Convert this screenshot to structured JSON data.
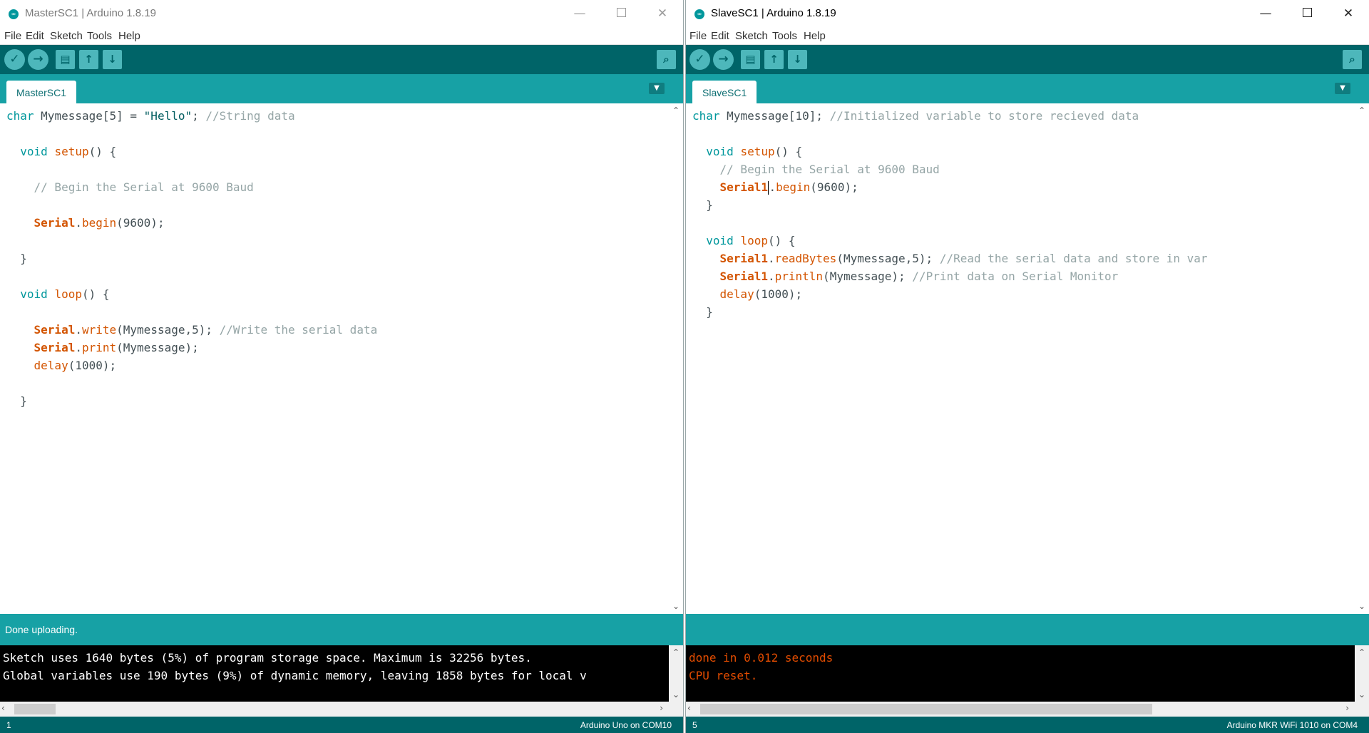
{
  "windows": {
    "master": {
      "title": "MasterSC1 | Arduino 1.8.19",
      "menu": [
        "File",
        "Edit",
        "Sketch",
        "Tools",
        "Help"
      ],
      "tab": "MasterSC1",
      "status": "Done uploading.",
      "console_lines": [
        "Sketch uses 1640 bytes (5%) of program storage space. Maximum is 32256 bytes.",
        "Global variables use 190 bytes (9%) of dynamic memory, leaving 1858 bytes for local v"
      ],
      "footer_line": "1",
      "footer_board": "Arduino Uno on COM10",
      "code_lines": [
        "char Mymessage[5] = \"Hello\"; //String data",
        "",
        "  void setup() {",
        "",
        "    // Begin the Serial at 9600 Baud",
        "",
        "    Serial.begin(9600);",
        "",
        "  }",
        "",
        "  void loop() {",
        "",
        "    Serial.write(Mymessage,5); //Write the serial data",
        "    Serial.print(Mymessage);",
        "    delay(1000);",
        "",
        "  }"
      ]
    },
    "slave": {
      "title": "SlaveSC1 | Arduino 1.8.19",
      "menu": [
        "File",
        "Edit",
        "Sketch",
        "Tools",
        "Help"
      ],
      "tab": "SlaveSC1",
      "status": "",
      "console_lines": [
        "done in 0.012 seconds",
        "CPU reset."
      ],
      "footer_line": "5",
      "footer_board": "Arduino MKR WiFi 1010 on COM4",
      "code_lines": [
        "char Mymessage[10]; //Initialized variable to store recieved data",
        "",
        "  void setup() {",
        "    // Begin the Serial at 9600 Baud",
        "    Serial1.begin(9600);",
        "  }",
        "",
        "  void loop() {",
        "    Serial1.readBytes(Mymessage,5); //Read the serial data and store in var",
        "    Serial1.println(Mymessage); //Print data on Serial Monitor",
        "    delay(1000);",
        "  }"
      ]
    }
  },
  "toolbar_icons": [
    "verify-icon",
    "upload-icon",
    "new-sketch-icon",
    "open-icon",
    "save-icon",
    "serial-monitor-icon"
  ],
  "colors": {
    "toolbar": "#006468",
    "tabbar": "#17a1a5",
    "keyword": "#00979c",
    "function": "#d35400",
    "comment": "#95a5a6",
    "console_bg": "#000000",
    "console_error": "#e34c00"
  }
}
